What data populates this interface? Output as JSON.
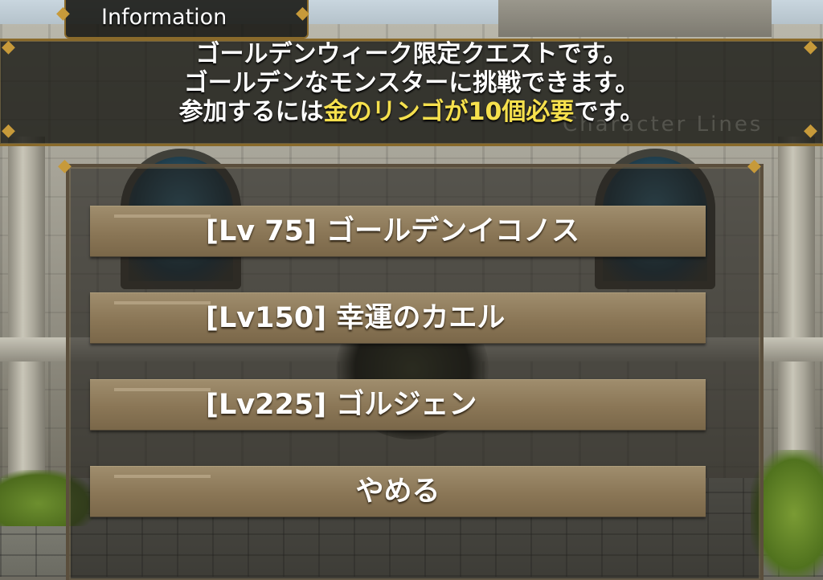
{
  "info": {
    "title": "Information",
    "watermark": "Character Lines",
    "lines": {
      "line1": "ゴールデンウィーク限定クエストです。",
      "line2": "ゴールデンなモンスターに挑戦できます。",
      "line3_pre": "参加するには",
      "line3_highlight": "金のリンゴが10個必要",
      "line3_post": "です。"
    },
    "highlight_color": "#f6e04d"
  },
  "menu": {
    "options": [
      {
        "label": "[Lv 75] ゴールデンイコノス"
      },
      {
        "label": "[Lv150] 幸運のカエル"
      },
      {
        "label": "[Lv225] ゴルジェン"
      }
    ],
    "cancel_label": "やめる"
  },
  "colors": {
    "button_fill": "#8a7656",
    "frame_gold": "#8a6a2b"
  }
}
